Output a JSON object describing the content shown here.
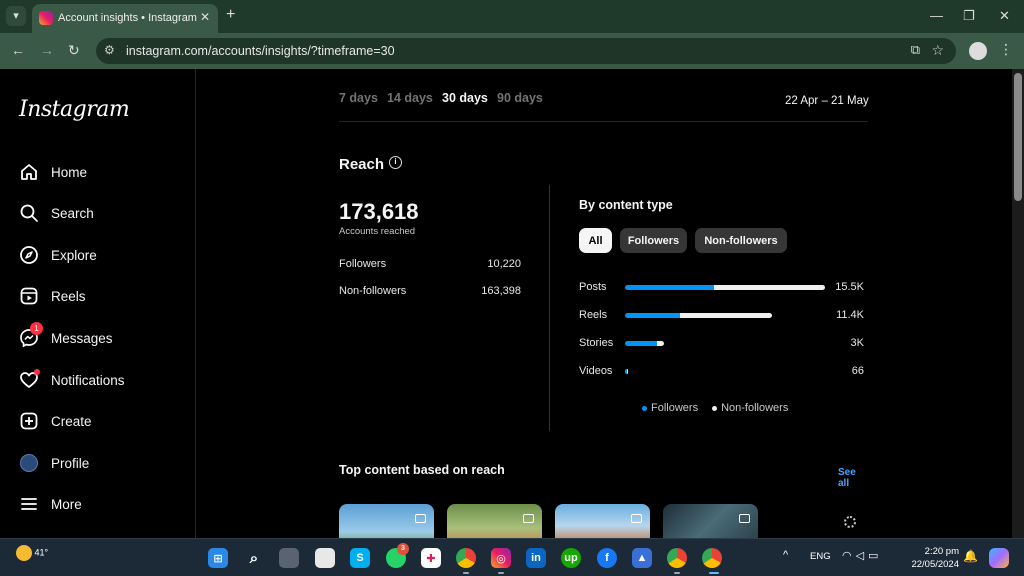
{
  "browser": {
    "tab_title": "Account insights • Instagram",
    "url": "instagram.com/accounts/insights/?timeframe=30"
  },
  "sidebar": {
    "logo": "Instagram",
    "items": [
      {
        "label": "Home",
        "icon": "home-icon"
      },
      {
        "label": "Search",
        "icon": "search-icon"
      },
      {
        "label": "Explore",
        "icon": "compass-icon"
      },
      {
        "label": "Reels",
        "icon": "reels-icon"
      },
      {
        "label": "Messages",
        "icon": "messenger-icon",
        "badge": "1"
      },
      {
        "label": "Notifications",
        "icon": "heart-icon"
      },
      {
        "label": "Create",
        "icon": "plus-square-icon"
      },
      {
        "label": "Profile",
        "icon": "avatar"
      },
      {
        "label": "More",
        "icon": "hamburger-icon"
      }
    ]
  },
  "timeframes": [
    {
      "label": "7 days",
      "active": false
    },
    {
      "label": "14 days",
      "active": false
    },
    {
      "label": "30 days",
      "active": true
    },
    {
      "label": "90 days",
      "active": false
    }
  ],
  "date_range": "22 Apr – 21 May",
  "reach": {
    "title": "Reach",
    "total": "173,618",
    "total_label": "Accounts reached",
    "rows": [
      {
        "label": "Followers",
        "value": "10,220"
      },
      {
        "label": "Non-followers",
        "value": "163,398"
      }
    ]
  },
  "content_type": {
    "title": "By content type",
    "filters": [
      "All",
      "Followers",
      "Non-followers"
    ],
    "selected_filter": "All",
    "colors": {
      "followers": "#0095f6",
      "non_followers": "#f0f0f0"
    }
  },
  "chart_data": {
    "type": "bar",
    "orientation": "horizontal",
    "stacked": true,
    "categories": [
      "Posts",
      "Reels",
      "Stories",
      "Videos"
    ],
    "value_labels": [
      "15.5K",
      "11.4K",
      "3K",
      "66"
    ],
    "totals": [
      15500,
      11400,
      3000,
      66
    ],
    "series": [
      {
        "name": "Followers",
        "values": [
          6900,
          4300,
          2500,
          40
        ]
      },
      {
        "name": "Non-followers",
        "values": [
          8600,
          7100,
          500,
          26
        ]
      }
    ],
    "legend": [
      "Followers",
      "Non-followers"
    ]
  },
  "top_content": {
    "title": "Top content based on reach",
    "see_all": "See all",
    "thumbnails": [
      {
        "type": "reel"
      },
      {
        "type": "carousel"
      },
      {
        "type": "carousel"
      },
      {
        "type": "reel"
      }
    ]
  },
  "taskbar": {
    "temperature": "41°",
    "messages_badge": "3",
    "language": "ENG",
    "time": "2:20 pm",
    "date": "22/05/2024"
  }
}
